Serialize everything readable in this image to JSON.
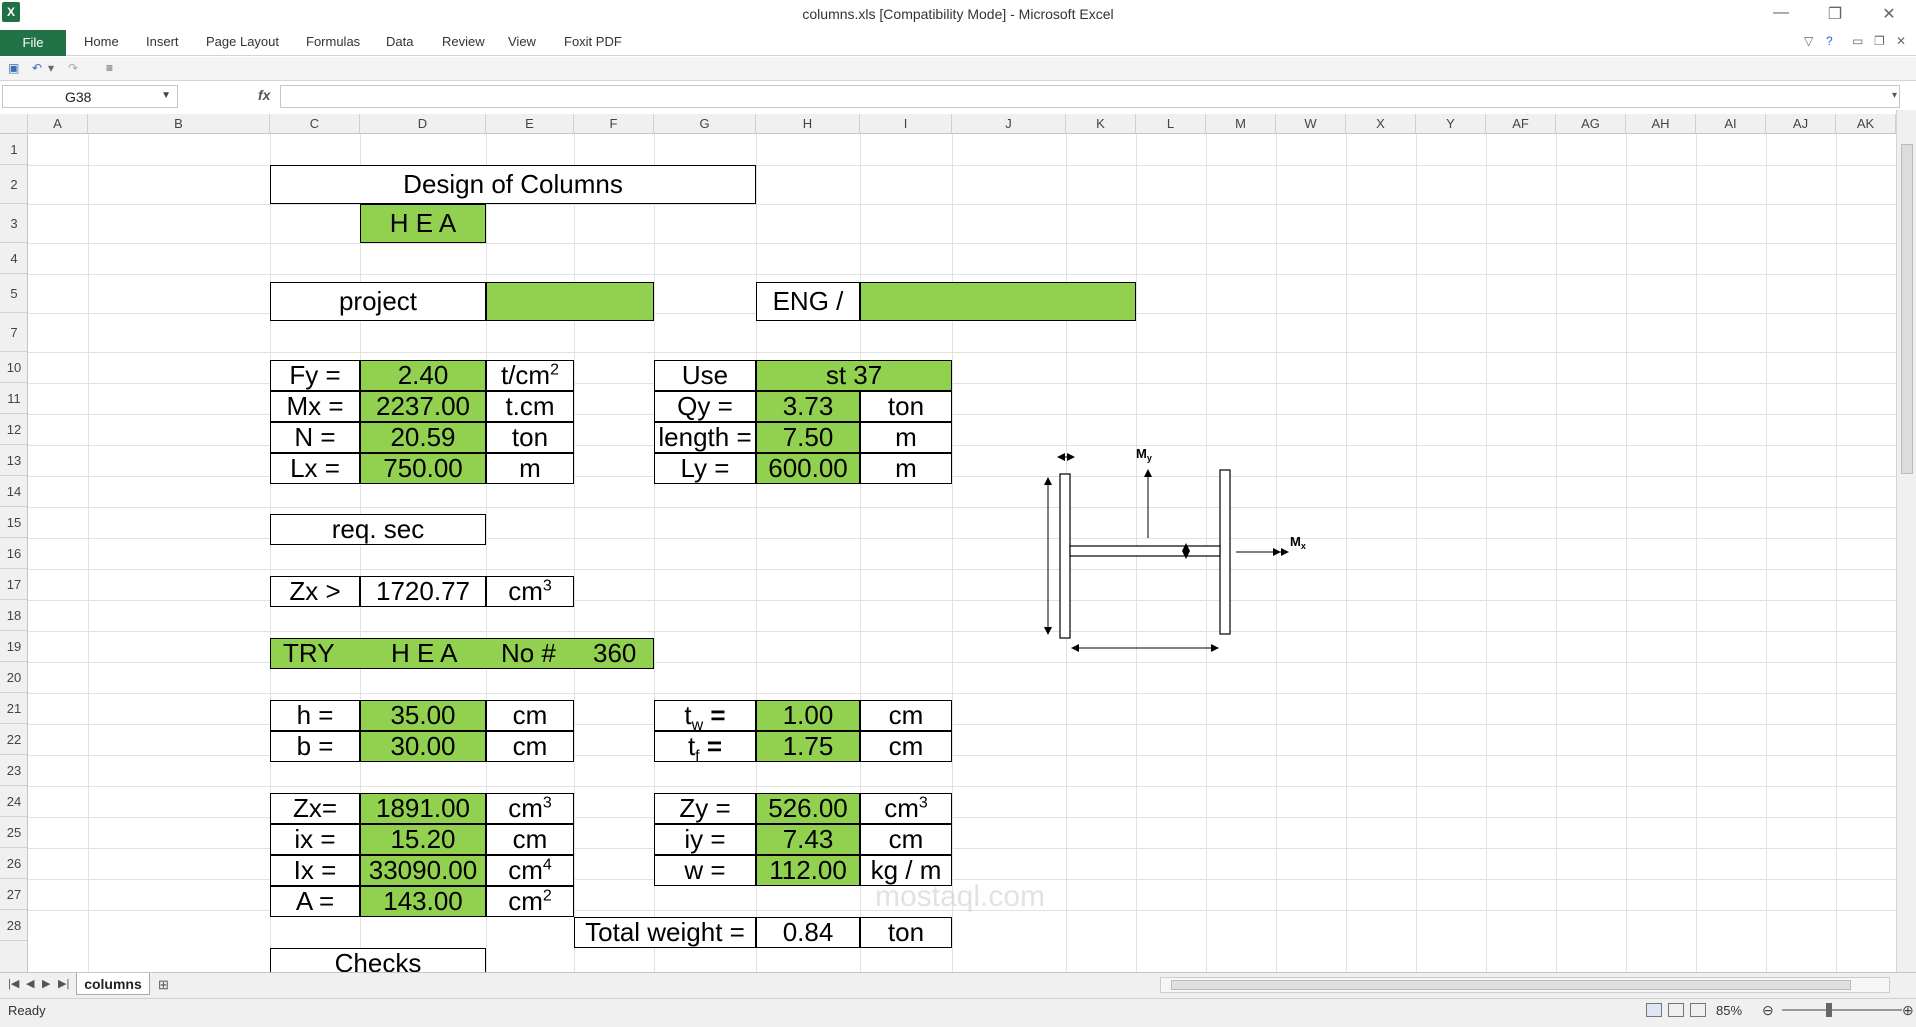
{
  "window": {
    "title": "columns.xls  [Compatibility Mode]  -  Microsoft Excel",
    "minimize": "—",
    "restore": "❐",
    "close": "✕"
  },
  "ribbon": {
    "tabs": [
      "File",
      "Home",
      "Insert",
      "Page Layout",
      "Formulas",
      "Data",
      "Review",
      "View",
      "Foxit PDF"
    ]
  },
  "formula_bar": {
    "name_box": "G38",
    "fx": "fx",
    "formula": ""
  },
  "columns": [
    "A",
    "B",
    "C",
    "D",
    "E",
    "F",
    "G",
    "H",
    "I",
    "J",
    "K",
    "L",
    "M",
    "W",
    "X",
    "Y",
    "AF",
    "AG",
    "AH",
    "AI",
    "AJ",
    "AK"
  ],
  "rows": [
    "1",
    "2",
    "3",
    "4",
    "5",
    "7",
    "10",
    "11",
    "12",
    "13",
    "14",
    "15",
    "16",
    "17",
    "18",
    "19",
    "20",
    "21",
    "22",
    "23",
    "24",
    "25",
    "26",
    "27",
    "28"
  ],
  "sheet": {
    "title": "Design of Columns",
    "section": "H E A",
    "project_label": "project",
    "project_value": "",
    "eng_label": "ENG /",
    "eng_value": "",
    "fy_label": "Fy =",
    "fy_value": "2.40",
    "fy_unit": "t/cm",
    "fy_unit_exp": "2",
    "mx_label": "Mx =",
    "mx_value": "2237.00",
    "mx_unit": "t.cm",
    "n_label": "N =",
    "n_value": "20.59",
    "n_unit": "ton",
    "lx_label": "Lx =",
    "lx_value": "750.00",
    "lx_unit": "m",
    "use_label": "Use",
    "use_value": "st 37",
    "qy_label": "Qy =",
    "qy_value": "3.73",
    "qy_unit": "ton",
    "length_label": "length =",
    "length_value": "7.50",
    "length_unit": "m",
    "ly_label": "Ly =",
    "ly_value": "600.00",
    "ly_unit": "m",
    "req_sec": "req. sec",
    "zx_req_label": "Zx >",
    "zx_req_value": "1720.77",
    "zx_req_unit": "cm",
    "zx_req_exp": "3",
    "try_label": "TRY",
    "try_section": "H E A",
    "try_no_label": "No #",
    "try_no": "360",
    "h_label": "h =",
    "h_value": "35.00",
    "h_unit": "cm",
    "b_label": "b =",
    "b_value": "30.00",
    "b_unit": "cm",
    "tw_label": "t",
    "tw_sub": "w",
    "tw_eq": " =",
    "tw_value": "1.00",
    "tw_unit": "cm",
    "tf_label": "t",
    "tf_sub": "f",
    "tf_eq": " =",
    "tf_value": "1.75",
    "tf_unit": "cm",
    "zx_label": "Zx=",
    "zx_value": "1891.00",
    "zx_unit": "cm",
    "zx_exp": "3",
    "ix_label": "ix =",
    "ix_value": "15.20",
    "ix_unit": "cm",
    "Ix_label": "Ix =",
    "Ix_value": "33090.00",
    "Ix_unit": "cm",
    "Ix_exp": "4",
    "a_label": "A =",
    "a_value": "143.00",
    "a_unit": "cm",
    "a_exp": "2",
    "zy_label": "Zy =",
    "zy_value": "526.00",
    "zy_unit": "cm",
    "zy_exp": "3",
    "iy_label": "iy =",
    "iy_value": "7.43",
    "iy_unit": "cm",
    "w_label": "w =",
    "w_value": "112.00",
    "w_unit": "kg / m",
    "total_label": "Total weight =",
    "total_value": "0.84",
    "total_unit": "ton",
    "checks": "Checks",
    "diagram_my": "M",
    "diagram_my_sub": "y",
    "diagram_mx": "M",
    "diagram_mx_sub": "x"
  },
  "sheet_tab": "columns",
  "status": {
    "ready": "Ready",
    "zoom": "85%"
  },
  "watermark": "mostaql.com",
  "colors": {
    "accent_green": "#92d050",
    "file_tab": "#217346"
  }
}
